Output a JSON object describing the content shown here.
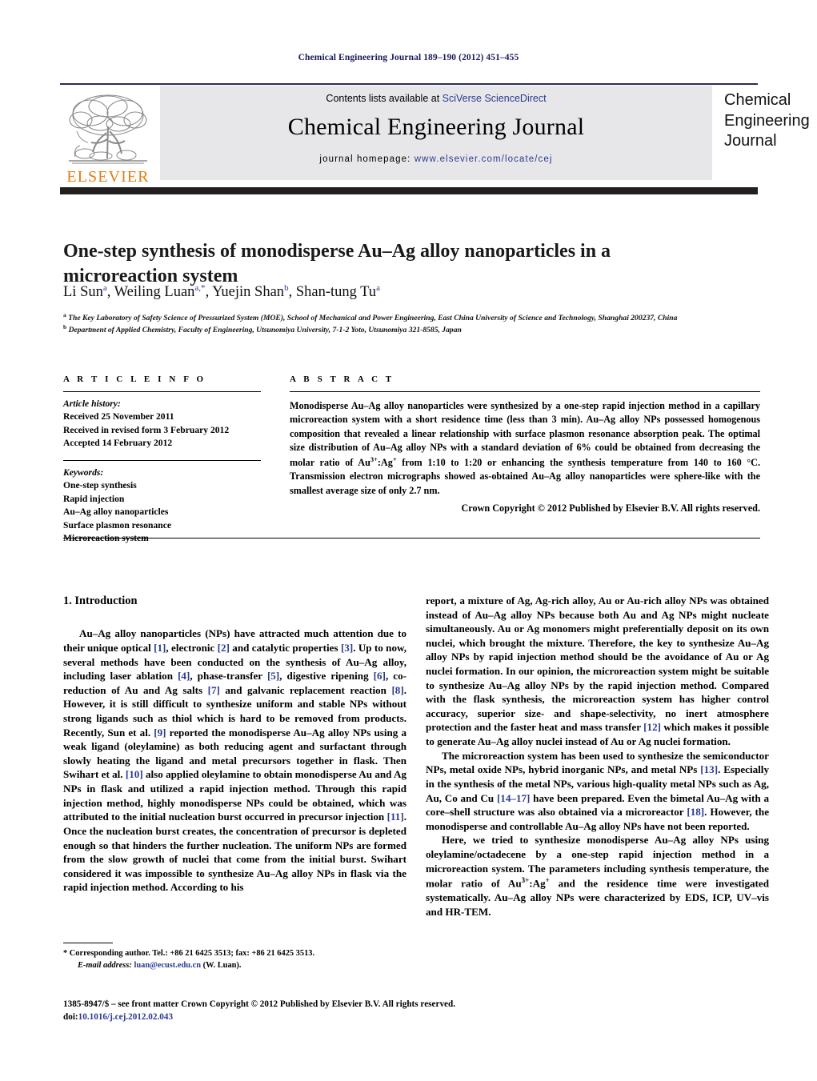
{
  "running_head": "Chemical Engineering Journal 189–190 (2012) 451–455",
  "masthead": {
    "contents_prefix": "Contents lists available at ",
    "contents_link": "SciVerse ScienceDirect",
    "journal_title": "Chemical Engineering Journal",
    "homepage_prefix": "journal homepage: ",
    "homepage_url": "www.elsevier.com/locate/cej",
    "publisher_wordmark": "ELSEVIER",
    "cover_line1": "Chemical",
    "cover_line2": "Engineering",
    "cover_line3": "Journal"
  },
  "article": {
    "title": "One-step synthesis of monodisperse Au–Ag alloy nanoparticles in a microreaction system",
    "authors_html": "Li Sun<sup>a</sup>, Weiling Luan<sup>a,*</sup>, Yuejin Shan<sup>b</sup>, Shan-tung Tu<sup>a</sup>",
    "affiliation_a": "The Key Laboratory of Safety Science of Pressurized System (MOE), School of Mechanical and Power Engineering, East China University of Science and Technology, Shanghai 200237, China",
    "affiliation_b": "Department of Applied Chemistry, Faculty of Engineering, Utsunomiya University, 7-1-2 Yoto, Utsunomiya 321-8585, Japan"
  },
  "article_info": {
    "heading": "A R T I C L E   I N F O",
    "history_label": "Article history:",
    "history": [
      "Received 25 November 2011",
      "Received in revised form 3 February 2012",
      "Accepted 14 February 2012"
    ],
    "keywords_label": "Keywords:",
    "keywords": [
      "One-step synthesis",
      "Rapid injection",
      "Au–Ag alloy nanoparticles",
      "Surface plasmon resonance",
      "Microreaction system"
    ]
  },
  "abstract": {
    "heading": "A B S T R A C T",
    "text_html": "Monodisperse Au–Ag alloy nanoparticles were synthesized by a one-step rapid injection method in a capillary microreaction system with a short residence time (less than 3 min). Au–Ag alloy NPs possessed homogenous composition that revealed a linear relationship with surface plasmon resonance absorption peak. The optimal size distribution of Au–Ag alloy NPs with a standard deviation of 6% could be obtained from decreasing the molar ratio of Au<sup>3+</sup>:Ag<sup>+</sup> from 1:10 to 1:20 or enhancing the synthesis temperature from 140 to 160 °C. Transmission electron micrographs showed as-obtained Au–Ag alloy nanoparticles were sphere-like with the smallest average size of only 2.7 nm.",
    "copyright": "Crown Copyright © 2012 Published by Elsevier B.V. All rights reserved."
  },
  "body": {
    "section_heading": "1. Introduction",
    "left_paragraphs_html": [
      "Au–Ag alloy nanoparticles (NPs) have attracted much attention due to their unique optical <span class=\"ref\">[1]</span>, electronic <span class=\"ref\">[2]</span> and catalytic properties <span class=\"ref\">[3]</span>. Up to now, several methods have been conducted on the synthesis of Au–Ag alloy, including laser ablation <span class=\"ref\">[4]</span>, phase-transfer <span class=\"ref\">[5]</span>, digestive ripening <span class=\"ref\">[6]</span>, co-reduction of Au and Ag salts <span class=\"ref\">[7]</span> and galvanic replacement reaction <span class=\"ref\">[8]</span>. However, it is still difficult to synthesize uniform and stable NPs without strong ligands such as thiol which is hard to be removed from products. Recently, Sun et al. <span class=\"ref\">[9]</span> reported the monodisperse Au–Ag alloy NPs using a weak ligand (oleylamine) as both reducing agent and surfactant through slowly heating the ligand and metal precursors together in flask. Then Swihart et al. <span class=\"ref\">[10]</span> also applied oleylamine to obtain monodisperse Au and Ag NPs in flask and utilized a rapid injection method. Through this rapid injection method, highly monodisperse NPs could be obtained, which was attributed to the initial nucleation burst occurred in precursor injection <span class=\"ref\">[11]</span>. Once the nucleation burst creates, the concentration of precursor is depleted enough so that hinders the further nucleation. The uniform NPs are formed from the slow growth of nuclei that come from the initial burst. Swihart considered it was impossible to synthesize Au–Ag alloy NPs in flask via the rapid injection method. According to his"
    ],
    "right_paragraphs_html": [
      "report, a mixture of Ag, Ag-rich alloy, Au or Au-rich alloy NPs was obtained instead of Au–Ag alloy NPs because both Au and Ag NPs might nucleate simultaneously. Au or Ag monomers might preferentially deposit on its own nuclei, which brought the mixture. Therefore, the key to synthesize Au–Ag alloy NPs by rapid injection method should be the avoidance of Au or Ag nuclei formation. In our opinion, the microreaction system might be suitable to synthesize Au–Ag alloy NPs by the rapid injection method. Compared with the flask synthesis, the microreaction system has higher control accuracy, superior size- and shape-selectivity, no inert atmosphere protection and the faster heat and mass transfer <span class=\"ref\">[12]</span> which makes it possible to generate Au–Ag alloy nuclei instead of Au or Ag nuclei formation.",
      "The microreaction system has been used to synthesize the semiconductor NPs, metal oxide NPs, hybrid inorganic NPs, and metal NPs <span class=\"ref\">[13]</span>. Especially in the synthesis of the metal NPs, various high-quality metal NPs such as Ag, Au, Co and Cu <span class=\"ref\">[14–17]</span> have been prepared. Even the bimetal Au–Ag with a core–shell structure was also obtained via a microreactor <span class=\"ref\">[18]</span>. However, the monodisperse and controllable Au–Ag alloy NPs have not been reported.",
      "Here, we tried to synthesize monodisperse Au–Ag alloy NPs using oleylamine/octadecene by a one-step rapid injection method in a microreaction system. The parameters including synthesis temperature, the molar ratio of Au<sup>3+</sup>:Ag<sup>+</sup> and the residence time were investigated systematically. Au–Ag alloy NPs were characterized by EDS, ICP, UV–vis and HR-TEM."
    ]
  },
  "footer": {
    "corresponding_html": "* Corresponding author. Tel.: +86 21 6425 3513; fax: +86 21 6425 3513.",
    "email_label": "E-mail address:",
    "email": "luan@ecust.edu.cn",
    "email_suffix": "(W. Luan).",
    "issn_line": "1385-8947/$ – see front matter Crown Copyright © 2012 Published by Elsevier B.V. All rights reserved.",
    "doi_label": "doi:",
    "doi_value": "10.1016/j.cej.2012.02.043"
  },
  "colors": {
    "link": "#2b3a8f",
    "elsevier_orange": "#e87b10",
    "grey_band": "#e7e7e9",
    "black_bar": "#231f20"
  }
}
